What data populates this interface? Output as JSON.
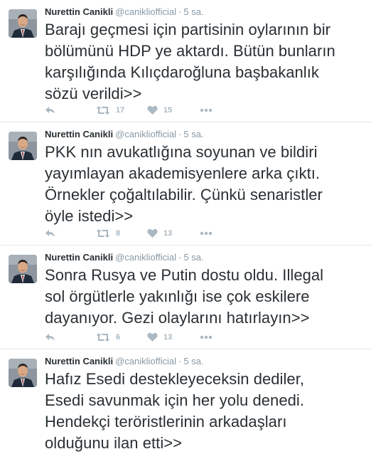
{
  "tweets": [
    {
      "name": "Nurettin Canikli",
      "handle": "@canikliofficial",
      "separator": "·",
      "time": "5 sa.",
      "lines": [
        "Barajı geçmesi için partisinin oylarının bir",
        "bölümünü HDP ye aktardı. Bütün bunların",
        "karşılığında Kılıçdaroğluna başbakanlık",
        "sözü verildi>>"
      ],
      "retweets": "17",
      "likes": "15"
    },
    {
      "name": "Nurettin Canikli",
      "handle": "@canikliofficial",
      "separator": "·",
      "time": "5 sa.",
      "lines": [
        "PKK nın avukatlığına soyunan ve bildiri",
        "yayımlayan akademisyenlere arka çıktı.",
        "Örnekler çoğaltılabilir. Çünkü senaristler",
        "öyle istedi>>"
      ],
      "retweets": "8",
      "likes": "13"
    },
    {
      "name": "Nurettin Canikli",
      "handle": "@canikliofficial",
      "separator": "·",
      "time": "5 sa.",
      "lines": [
        "Sonra Rusya ve Putin dostu oldu. Illegal",
        "sol örgütlerle yakınlığı ise çok eskilere",
        "dayanıyor. Gezi olaylarını hatırlayın>>"
      ],
      "retweets": "6",
      "likes": "13"
    },
    {
      "name": "Nurettin Canikli",
      "handle": "@canikliofficial",
      "separator": "·",
      "time": "5 sa.",
      "lines": [
        "Hafız Esedi destekleyeceksin dediler,",
        "Esedi savunmak için her yolu denedi.",
        "Hendekçi teröristlerinin arkadaşları",
        "olduğunu ilan etti>>"
      ]
    }
  ],
  "icons": {
    "reply": "reply-icon",
    "retweet": "retweet-icon",
    "like": "heart-icon",
    "more": "more-dots-icon"
  },
  "colors": {
    "text": "#292f33",
    "muted": "#8899a6",
    "action": "#aab8c2",
    "divider": "#e1e8ed"
  }
}
